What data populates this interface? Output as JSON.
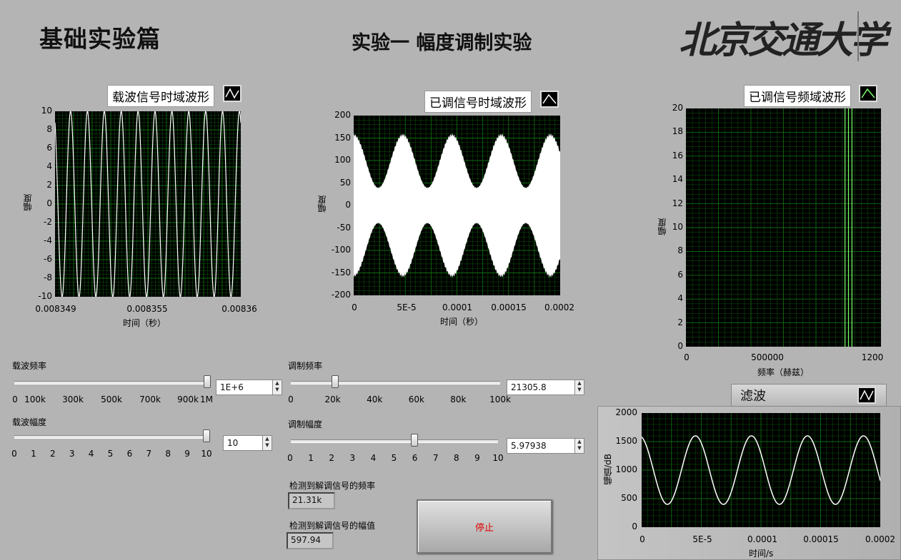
{
  "header": {
    "main_title": "基础实验篇",
    "experiment_title": "实验一 幅度调制实验",
    "logo_text": "北京交通大学"
  },
  "colors": {
    "background": "#b4b4b4",
    "plot_bg": "#000000",
    "grid": "#0f6b0f",
    "trace_white": "#ffffff",
    "trace_green": "#7cff6a",
    "stop_text": "#e00000"
  },
  "carrier_plot": {
    "title": "载波信号时域波形",
    "ylabel": "幅度",
    "xlabel": "时间（秒）",
    "yticks": [
      "10",
      "8",
      "6",
      "4",
      "2",
      "0",
      "-2",
      "-4",
      "-6",
      "-8",
      "-10"
    ],
    "xticks": [
      "0.008349",
      "0.008355",
      "0.00836"
    ]
  },
  "modulated_plot": {
    "title": "已调信号时域波形",
    "ylabel": "幅度",
    "xlabel": "时间（秒）",
    "yticks": [
      "200",
      "150",
      "100",
      "50",
      "0",
      "-50",
      "-100",
      "-150",
      "-200"
    ],
    "xticks": [
      "0",
      "5E-5",
      "0.0001",
      "0.00015",
      "0.0002"
    ]
  },
  "spectrum_plot": {
    "title": "已调信号频域波形",
    "ylabel": "幅度",
    "xlabel": "频率（赫兹）",
    "yticks": [
      "20",
      "18",
      "16",
      "14",
      "12",
      "10",
      "8",
      "6",
      "4",
      "2",
      "0"
    ],
    "xticks": [
      "0",
      "500000",
      "1200"
    ]
  },
  "filter_plot": {
    "tab_label": "滤波",
    "ylabel": "幅值/dB",
    "xlabel": "时间/s",
    "yticks": [
      "2000",
      "1500",
      "1000",
      "500",
      "0"
    ],
    "xticks": [
      "0",
      "5E-5",
      "0.0001",
      "0.00015",
      "0.0002"
    ]
  },
  "controls": {
    "carrier_freq": {
      "label": "载波频率",
      "value": "1E+6",
      "ticks": [
        "0",
        "100k",
        "300k",
        "500k",
        "700k",
        "900k",
        "1M"
      ],
      "level": 1.0
    },
    "carrier_amp": {
      "label": "载波幅度",
      "value": "10",
      "ticks": [
        "0",
        "1",
        "2",
        "3",
        "4",
        "5",
        "6",
        "7",
        "8",
        "9",
        "10"
      ],
      "level": 1.0
    },
    "mod_freq": {
      "label": "调制频率",
      "value": "21305.8",
      "ticks": [
        "0",
        "20k",
        "40k",
        "60k",
        "80k",
        "100k"
      ],
      "level": 0.213
    },
    "mod_amp": {
      "label": "调制幅度",
      "value": "5.97938",
      "ticks": [
        "0",
        "1",
        "2",
        "3",
        "4",
        "5",
        "6",
        "7",
        "8",
        "9",
        "10"
      ],
      "level": 0.598
    }
  },
  "indicators": {
    "freq_label": "检测到解调信号的频率",
    "freq_value": "21.31k",
    "amp_label": "检测到解调信号的幅值",
    "amp_value": "597.94"
  },
  "stop_button": {
    "label": "停止"
  },
  "chart_data": [
    {
      "type": "line",
      "title": "载波信号时域波形",
      "xlabel": "时间（秒）",
      "ylabel": "幅度",
      "xlim": [
        0.008349,
        0.00836
      ],
      "ylim": [
        -10,
        10
      ],
      "series": [
        {
          "amplitude": 10,
          "cycles_visible": 11
        }
      ]
    },
    {
      "type": "line",
      "title": "已调信号时域波形",
      "xlabel": "时间（秒）",
      "ylabel": "幅度",
      "xlim": [
        0,
        0.0002
      ],
      "ylim": [
        -200,
        200
      ],
      "series": [
        {
          "envelope_max": 160,
          "envelope_min": 40,
          "envelope_cycles": 4.2
        }
      ]
    },
    {
      "type": "line",
      "title": "已调信号频域波形",
      "xlabel": "频率（赫兹）",
      "ylabel": "幅度",
      "xlim": [
        0,
        1200000
      ],
      "ylim": [
        0,
        20
      ],
      "series": [
        {
          "peaks_x": [
            978694,
            1000000,
            1021306
          ]
        }
      ]
    },
    {
      "type": "line",
      "xlabel": "时间/s",
      "ylabel": "幅值/dB",
      "xlim": [
        0,
        0.0002
      ],
      "ylim": [
        0,
        2000
      ],
      "series": [
        {
          "center": 1000,
          "amplitude": 600,
          "cycles_visible": 4.26
        }
      ]
    }
  ]
}
